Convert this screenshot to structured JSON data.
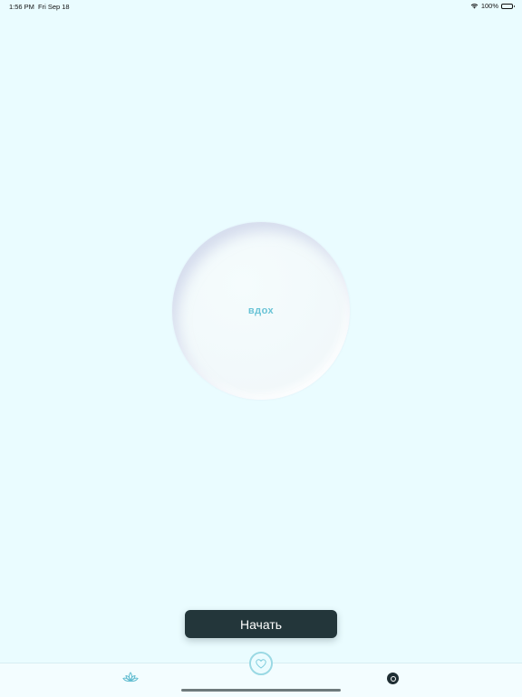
{
  "status_bar": {
    "time": "1:56 PM",
    "date": "Fri Sep 18",
    "battery": "100%",
    "icons": [
      "wifi-icon",
      "battery-icon"
    ]
  },
  "breathing": {
    "phase_label": "вдох"
  },
  "actions": {
    "start_label": "Начать"
  },
  "tab_bar": {
    "items": [
      {
        "icon": "lotus-icon",
        "selected": false
      },
      {
        "icon": "heart-icon",
        "selected": true
      },
      {
        "icon": "circle-target-icon",
        "selected": false
      }
    ]
  },
  "colors": {
    "background": "#eafcff",
    "accent": "#69c3d6",
    "button": "#23363a",
    "tab_highlight": "#9ad9e4"
  }
}
